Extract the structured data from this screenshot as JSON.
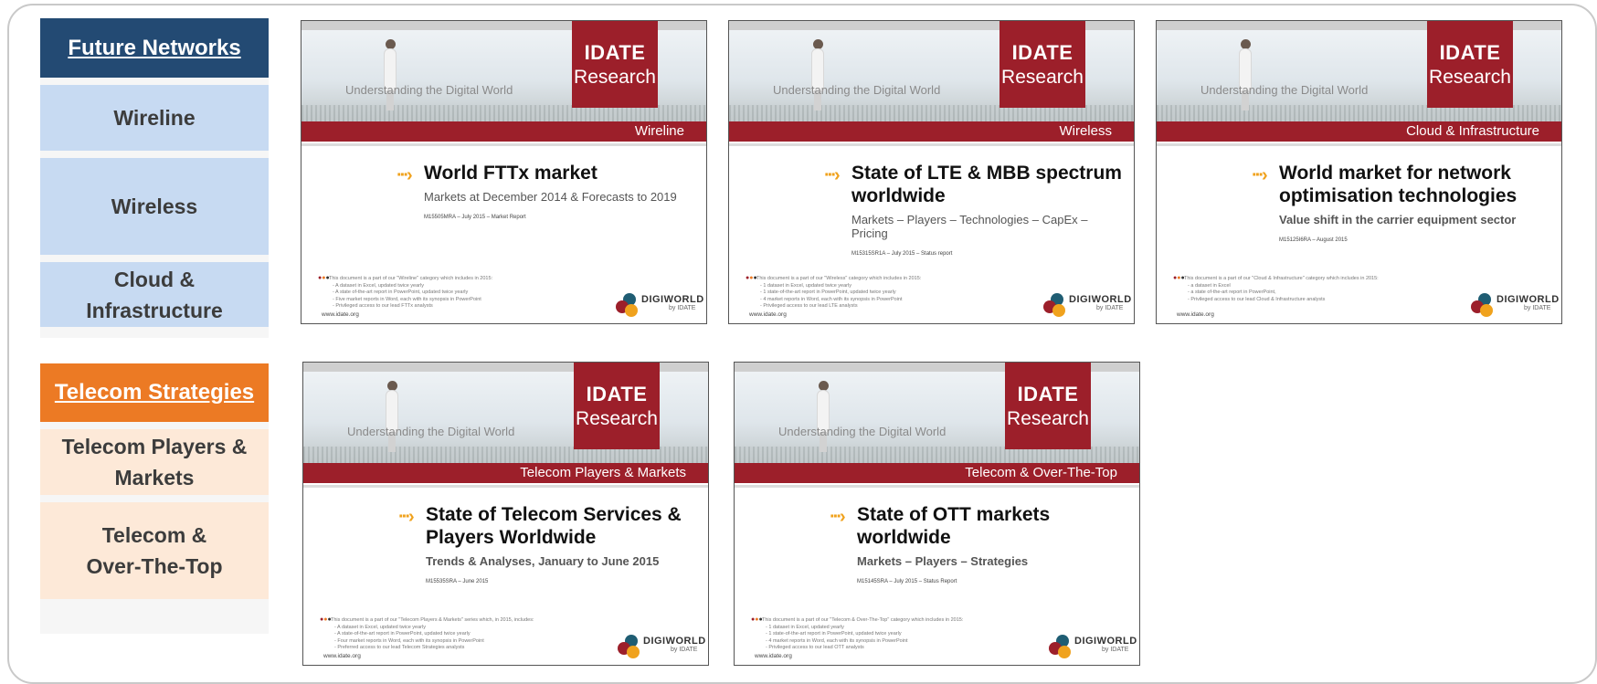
{
  "sidebar_networks": {
    "header": "Future Networks",
    "items": [
      "Wireline",
      "Wireless",
      "Cloud &\nInfrastructure"
    ]
  },
  "sidebar_telecom": {
    "header": "Telecom Strategies",
    "items": [
      "Telecom Players &\nMarkets",
      "Telecom &\nOver-The-Top"
    ]
  },
  "cards": [
    {
      "tagline": "Understanding the Digital World",
      "logo_line1": "IDATE",
      "logo_line2": "Research",
      "category": "Wireline",
      "title": "World FTTx market",
      "subtitle": "Markets at December 2014 & Forecasts to 2019",
      "code": "M15505MRA – July 2015 – Market Report",
      "fine": [
        "This document is a part of our \"Wireline\" category which includes in 2015:",
        "- A dataset in Excel, updated twice yearly",
        "- A state of-the-art report in PowerPoint, updated twice yearly",
        "- Five market reports in Word, each with its synopsis in PowerPoint",
        "- Privileged access to our lead FTTx analysts"
      ],
      "url": "www.idate.org",
      "brand": "DIGIWORLD",
      "brand_by": "by IDATE"
    },
    {
      "tagline": "Understanding the Digital World",
      "logo_line1": "IDATE",
      "logo_line2": "Research",
      "category": "Wireless",
      "title": "State of LTE & MBB spectrum worldwide",
      "subtitle": "Markets – Players – Technologies – CapEx – Pricing",
      "code": "M15315SR1A – July 2015 – Status report",
      "fine": [
        "This document is a part of our \"Wireless\" category which includes in 2015:",
        "- 1 dataset in Excel, updated twice yearly",
        "- 1 state-of-the-art report in PowerPoint, updated twice yearly",
        "- 4 market reports in Word, each with its synopsis in PowerPoint",
        "- Privileged access to our lead LTE analysts"
      ],
      "url": "www.idate.org",
      "brand": "DIGIWORLD",
      "brand_by": "by IDATE"
    },
    {
      "tagline": "Understanding the Digital World",
      "logo_line1": "IDATE",
      "logo_line2": "Research",
      "category": "Cloud & Infrastructure",
      "title": "World market for network optimisation technologies",
      "subtitle": "Value shift in the carrier equipment sector",
      "code": "M15125I6RA – August 2015",
      "fine": [
        "This document is a part of our \"Cloud & Infrastructure\" category which includes in 2015:",
        "- a dataset in Excel",
        "- a state of-the-art report in PowerPoint,",
        "- Privileged access to our lead Cloud & Infrastructure analysts"
      ],
      "url": "www.idate.org",
      "brand": "DIGIWORLD",
      "brand_by": "by IDATE"
    },
    {
      "tagline": "Understanding the Digital World",
      "logo_line1": "IDATE",
      "logo_line2": "Research",
      "category": "Telecom Players & Markets",
      "title": "State of Telecom Services & Players Worldwide",
      "subtitle": "Trends & Analyses, January to June 2015",
      "code": "M15535SRA – June 2015",
      "fine": [
        "This document is a part of our \"Telecom Players & Markets\" series which, in 2015, includes:",
        "- A dataset in Excel, updated twice yearly",
        "- A state-of-the-art report in PowerPoint, updated twice yearly",
        "- Four market reports in Word, each with its synopsis in PowerPoint",
        "- Preferred access to our lead Telecom Strategies analysts"
      ],
      "url": "www.idate.org",
      "brand": "DIGIWORLD",
      "brand_by": "by IDATE"
    },
    {
      "tagline": "Understanding the Digital World",
      "logo_line1": "IDATE",
      "logo_line2": "Research",
      "category": "Telecom & Over-The-Top",
      "title": "State of OTT markets worldwide",
      "subtitle": "Markets – Players – Strategies",
      "code": "M15145SRA – July 2015 – Status Report",
      "fine": [
        "This document is a part of our \"Telecom & Over-The-Top\" category which includes in 2015:",
        "- 1 dataset in Excel, updated yearly",
        "- 1 state-of-the-art report in PowerPoint, updated twice yearly",
        "- 4 market reports in Word, each with its synopsis in PowerPoint",
        "- Privileged access to our lead OTT analysts"
      ],
      "url": "www.idate.org",
      "brand": "DIGIWORLD",
      "brand_by": "by IDATE"
    }
  ]
}
